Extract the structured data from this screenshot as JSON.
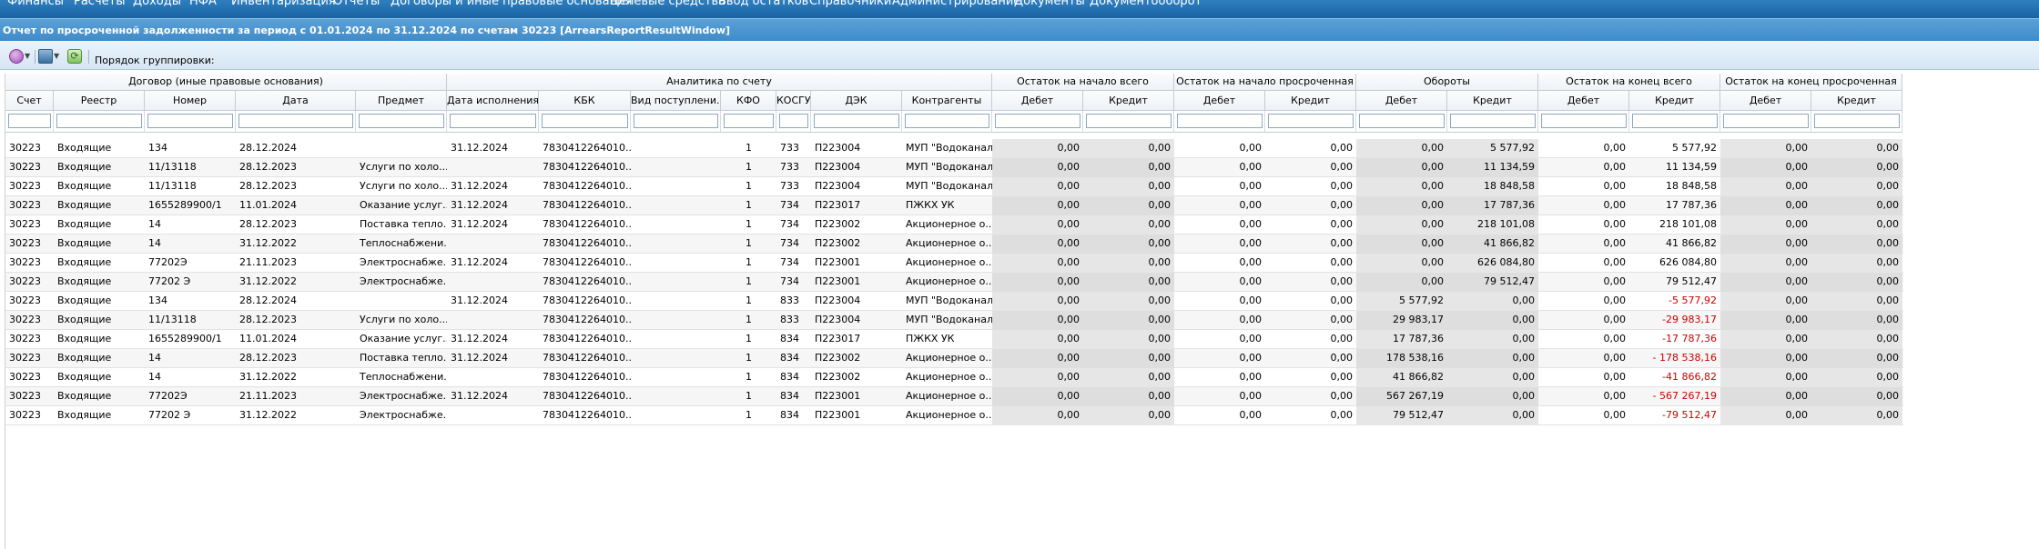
{
  "menu": [
    "Финансы",
    "Расчеты",
    "Доходы",
    "НФА",
    "Инвентаризация",
    "Отчеты",
    "Договоры и иные правовые основания",
    "Целевые средства",
    "Ввод остатков",
    "Справочники",
    "Администрирование",
    "Документы",
    "Документооборот"
  ],
  "window_title": "Отчет по просроченной задолженности за период с 01.01.2024 по 31.12.2024 по счетам 30223 [ArrearsReportResultWindow]",
  "toolbar": {
    "grouping_label": "Порядок группировки:"
  },
  "groups": [
    "Договор (иные правовые основания)",
    "Аналитика по счету",
    "Остаток на начало всего",
    "Остаток на начало просроченная",
    "Обороты",
    "Остаток на конец всего",
    "Остаток на конец просроченная"
  ],
  "columns": [
    "Счет",
    "Реестр",
    "Номер",
    "Дата",
    "Предмет",
    "Дата исполнения",
    "КБК",
    "Вид поступлени...",
    "КФО",
    "КОСГУ",
    "ДЭК",
    "Контрагенты",
    "Дебет",
    "Кредит",
    "Дебет",
    "Кредит",
    "Дебет",
    "Кредит",
    "Дебет",
    "Кредит",
    "Дебет",
    "Кредит"
  ],
  "rows": [
    [
      "30223",
      "Входящие",
      "134",
      "28.12.2024",
      "",
      "31.12.2024",
      "7830412264010...",
      "",
      "1",
      "733",
      "П223004",
      "МУП \"Водоканал\"",
      "0,00",
      "0,00",
      "0,00",
      "0,00",
      "0,00",
      "5 577,92",
      "0,00",
      "5 577,92",
      "0,00",
      "0,00"
    ],
    [
      "30223",
      "Входящие",
      "11/13118",
      "28.12.2023",
      "Услуги по холо...",
      "",
      "7830412264010...",
      "",
      "1",
      "733",
      "П223004",
      "МУП \"Водоканал\"",
      "0,00",
      "0,00",
      "0,00",
      "0,00",
      "0,00",
      "11 134,59",
      "0,00",
      "11 134,59",
      "0,00",
      "0,00"
    ],
    [
      "30223",
      "Входящие",
      "11/13118",
      "28.12.2023",
      "Услуги по холо...",
      "31.12.2024",
      "7830412264010...",
      "",
      "1",
      "733",
      "П223004",
      "МУП \"Водоканал\"",
      "0,00",
      "0,00",
      "0,00",
      "0,00",
      "0,00",
      "18 848,58",
      "0,00",
      "18 848,58",
      "0,00",
      "0,00"
    ],
    [
      "30223",
      "Входящие",
      "1655289900/1",
      "11.01.2024",
      "Оказание услуг...",
      "31.12.2024",
      "7830412264010...",
      "",
      "1",
      "734",
      "П223017",
      "ПЖКХ УК",
      "0,00",
      "0,00",
      "0,00",
      "0,00",
      "0,00",
      "17 787,36",
      "0,00",
      "17 787,36",
      "0,00",
      "0,00"
    ],
    [
      "30223",
      "Входящие",
      "14",
      "28.12.2023",
      "Поставка тепло...",
      "31.12.2024",
      "7830412264010...",
      "",
      "1",
      "734",
      "П223002",
      "Акционерное о...",
      "0,00",
      "0,00",
      "0,00",
      "0,00",
      "0,00",
      "218 101,08",
      "0,00",
      "218 101,08",
      "0,00",
      "0,00"
    ],
    [
      "30223",
      "Входящие",
      "14",
      "31.12.2022",
      "Теплоснабжени...",
      "",
      "7830412264010...",
      "",
      "1",
      "734",
      "П223002",
      "Акционерное о...",
      "0,00",
      "0,00",
      "0,00",
      "0,00",
      "0,00",
      "41 866,82",
      "0,00",
      "41 866,82",
      "0,00",
      "0,00"
    ],
    [
      "30223",
      "Входящие",
      "77202Э",
      "21.11.2023",
      "Электроснабже...",
      "31.12.2024",
      "7830412264010...",
      "",
      "1",
      "734",
      "П223001",
      "Акционерное о...",
      "0,00",
      "0,00",
      "0,00",
      "0,00",
      "0,00",
      "626 084,80",
      "0,00",
      "626 084,80",
      "0,00",
      "0,00"
    ],
    [
      "30223",
      "Входящие",
      "77202 Э",
      "31.12.2022",
      "Электроснабже...",
      "",
      "7830412264010...",
      "",
      "1",
      "734",
      "П223001",
      "Акционерное о...",
      "0,00",
      "0,00",
      "0,00",
      "0,00",
      "0,00",
      "79 512,47",
      "0,00",
      "79 512,47",
      "0,00",
      "0,00"
    ],
    [
      "30223",
      "Входящие",
      "134",
      "28.12.2024",
      "",
      "31.12.2024",
      "7830412264010...",
      "",
      "1",
      "833",
      "П223004",
      "МУП \"Водоканал\"",
      "0,00",
      "0,00",
      "0,00",
      "0,00",
      "5 577,92",
      "0,00",
      "0,00",
      "-5 577,92",
      "0,00",
      "0,00"
    ],
    [
      "30223",
      "Входящие",
      "11/13118",
      "28.12.2023",
      "Услуги по холо...",
      "",
      "7830412264010...",
      "",
      "1",
      "833",
      "П223004",
      "МУП \"Водоканал\"",
      "0,00",
      "0,00",
      "0,00",
      "0,00",
      "29 983,17",
      "0,00",
      "0,00",
      "-29 983,17",
      "0,00",
      "0,00"
    ],
    [
      "30223",
      "Входящие",
      "1655289900/1",
      "11.01.2024",
      "Оказание услуг...",
      "31.12.2024",
      "7830412264010...",
      "",
      "1",
      "834",
      "П223017",
      "ПЖКХ УК",
      "0,00",
      "0,00",
      "0,00",
      "0,00",
      "17 787,36",
      "0,00",
      "0,00",
      "-17 787,36",
      "0,00",
      "0,00"
    ],
    [
      "30223",
      "Входящие",
      "14",
      "28.12.2023",
      "Поставка тепло...",
      "31.12.2024",
      "7830412264010...",
      "",
      "1",
      "834",
      "П223002",
      "Акционерное о...",
      "0,00",
      "0,00",
      "0,00",
      "0,00",
      "178 538,16",
      "0,00",
      "0,00",
      "- 178 538,16",
      "0,00",
      "0,00"
    ],
    [
      "30223",
      "Входящие",
      "14",
      "31.12.2022",
      "Теплоснабжени...",
      "",
      "7830412264010...",
      "",
      "1",
      "834",
      "П223002",
      "Акционерное о...",
      "0,00",
      "0,00",
      "0,00",
      "0,00",
      "41 866,82",
      "0,00",
      "0,00",
      "-41 866,82",
      "0,00",
      "0,00"
    ],
    [
      "30223",
      "Входящие",
      "77202Э",
      "21.11.2023",
      "Электроснабже...",
      "31.12.2024",
      "7830412264010...",
      "",
      "1",
      "834",
      "П223001",
      "Акционерное о...",
      "0,00",
      "0,00",
      "0,00",
      "0,00",
      "567 267,19",
      "0,00",
      "0,00",
      "- 567 267,19",
      "0,00",
      "0,00"
    ],
    [
      "30223",
      "Входящие",
      "77202 Э",
      "31.12.2022",
      "Электроснабже...",
      "",
      "7830412264010...",
      "",
      "1",
      "834",
      "П223001",
      "Акционерное о...",
      "0,00",
      "0,00",
      "0,00",
      "0,00",
      "79 512,47",
      "0,00",
      "0,00",
      "-79 512,47",
      "0,00",
      "0,00"
    ]
  ],
  "colors": {
    "negative": "#cc0000",
    "summary_bg": "#e4e4e4",
    "menubar": "#1b63a3",
    "titlebar": "#3f8ccb"
  },
  "icons": [
    "add-menu-icon",
    "print-menu-icon",
    "refresh-icon"
  ]
}
